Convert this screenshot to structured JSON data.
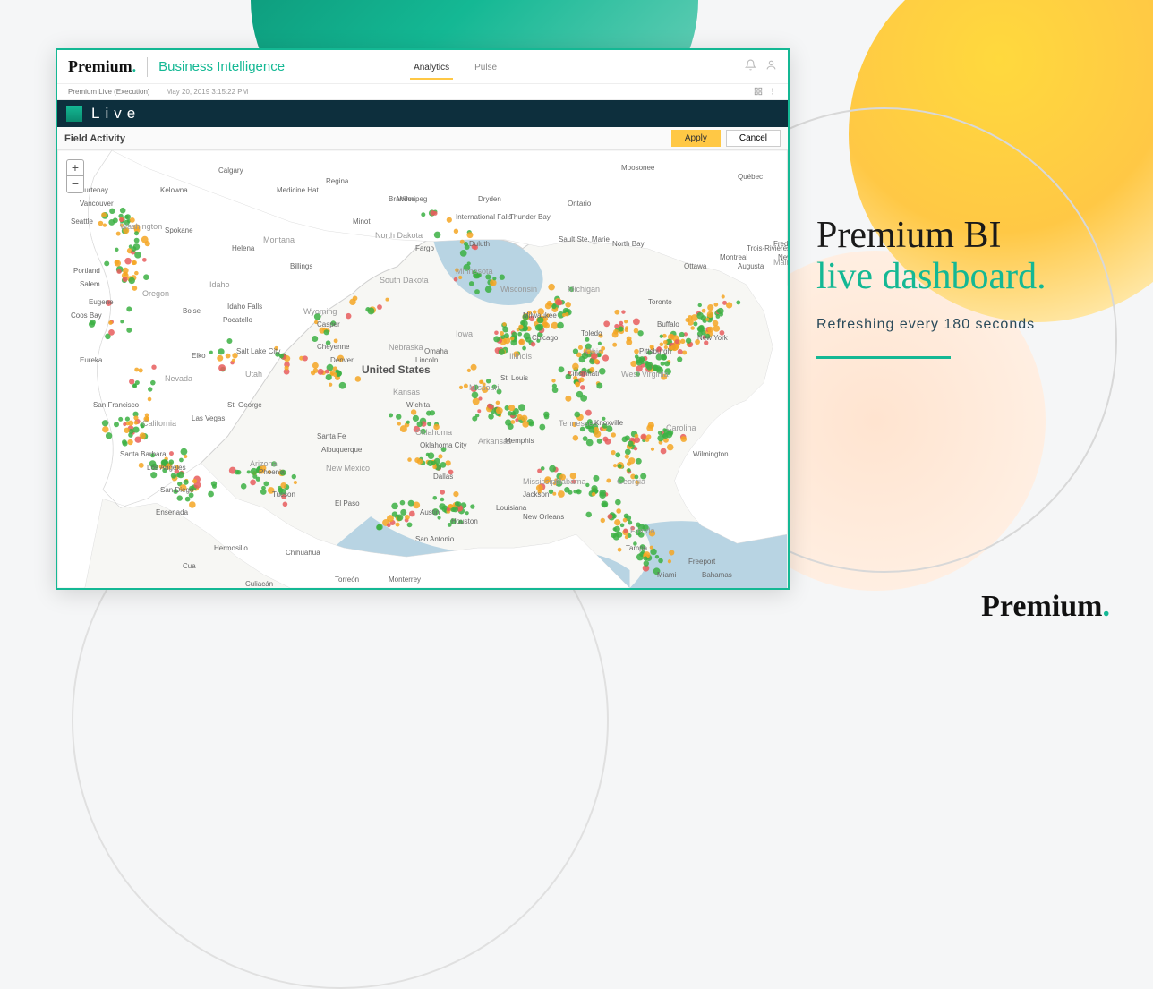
{
  "brand": {
    "name": "Premium",
    "dot": ".",
    "sub": "Business Intelligence"
  },
  "tabs": {
    "analytics": "Analytics",
    "pulse": "Pulse"
  },
  "subheader": {
    "breadcrumb": "Premium Live (Execution)",
    "timestamp": "May 20, 2019 3:15:22 PM"
  },
  "darkbar": {
    "title": "Live"
  },
  "toolbar": {
    "title": "Field Activity",
    "apply": "Apply",
    "cancel": "Cancel"
  },
  "zoom": {
    "in": "+",
    "out": "−"
  },
  "map": {
    "country_label": "United States",
    "neighbor_labels": [
      "Ontario",
      "Québec",
      "Bahamas"
    ],
    "state_labels": [
      "Washington",
      "Oregon",
      "Idaho",
      "Montana",
      "North Dakota",
      "South Dakota",
      "Minnesota",
      "Wisconsin",
      "Michigan",
      "Maine",
      "Nevada",
      "Utah",
      "Wyoming",
      "Nebraska",
      "Iowa",
      "Illinois",
      "Ohio",
      "West Virginia",
      "California",
      "Arizona",
      "New Mexico",
      "Kansas",
      "Missouri",
      "Tennessee",
      "Carolina",
      "Carolina",
      "Oklahoma",
      "Arkansas",
      "Mississippi",
      "Alabama",
      "Georgia",
      "Florida"
    ],
    "city_labels": [
      "Vancouver",
      "Calgary",
      "Regina",
      "Winnipeg",
      "Moosonee",
      "Seattle",
      "Spokane",
      "Kelowna",
      "Medicine Hat",
      "Brandon",
      "Dryden",
      "Thunder Bay",
      "Sault Ste. Marie",
      "North Bay",
      "Montreal",
      "Ottawa",
      "Fredericton",
      "Trois-Rivières",
      "New Bri",
      "Portland",
      "Salem",
      "Eugene",
      "Helena",
      "Billings",
      "Minot",
      "Fargo",
      "International Falls",
      "Duluth",
      "Coos Bay",
      "Boise",
      "Idaho Falls",
      "Pocatello",
      "Casper",
      "Cheyenne",
      "Minneapolis",
      "Milwaukee",
      "Chicago",
      "Toronto",
      "New York",
      "Buffalo",
      "Eureka",
      "Elko",
      "Salt Lake City",
      "Denver",
      "Omaha",
      "Lincoln",
      "St. Louis",
      "Cincinnati",
      "Pittsburgh",
      "San Francisco",
      "Las Vegas",
      "St. George",
      "Wichita",
      "Kansas",
      "Knoxville",
      "Santa Barbara",
      "Los Angeles",
      "San Diego",
      "Phoenix",
      "Tucson",
      "Santa Fe",
      "Albuquerque",
      "Oklahoma City",
      "Dallas",
      "Memphis",
      "Jackson",
      "Wilmington",
      "Augusta",
      "Ensenada",
      "El Paso",
      "Austin",
      "Houston",
      "New Orleans",
      "Tampa",
      "Miami",
      "Freeport",
      "Hermosillo",
      "Chihuahua",
      "Cua",
      "San Antonio",
      "Culiacán",
      "Torreón",
      "Monterrey",
      "Courtenay",
      "Toledo",
      "Louisiana"
    ]
  },
  "promo": {
    "line1": "Premium BI",
    "line2": "live dashboard.",
    "sub": "Refreshing every 180 seconds"
  },
  "footer_brand": "Premium"
}
